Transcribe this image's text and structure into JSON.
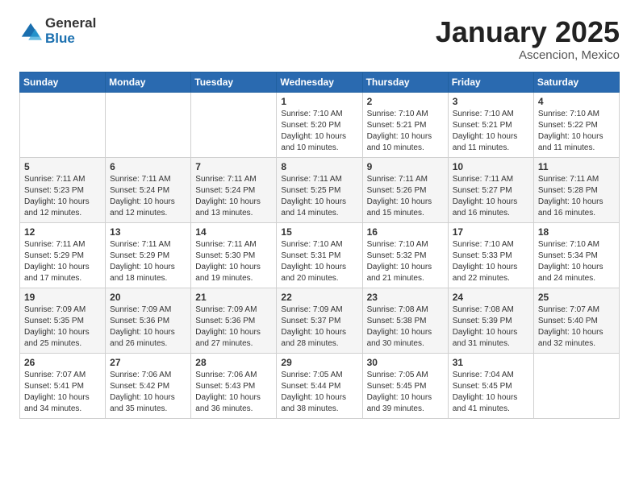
{
  "header": {
    "logo_general": "General",
    "logo_blue": "Blue",
    "title": "January 2025",
    "location": "Ascencion, Mexico"
  },
  "days_of_week": [
    "Sunday",
    "Monday",
    "Tuesday",
    "Wednesday",
    "Thursday",
    "Friday",
    "Saturday"
  ],
  "weeks": [
    [
      {
        "day": "",
        "info": ""
      },
      {
        "day": "",
        "info": ""
      },
      {
        "day": "",
        "info": ""
      },
      {
        "day": "1",
        "info": "Sunrise: 7:10 AM\nSunset: 5:20 PM\nDaylight: 10 hours\nand 10 minutes."
      },
      {
        "day": "2",
        "info": "Sunrise: 7:10 AM\nSunset: 5:21 PM\nDaylight: 10 hours\nand 10 minutes."
      },
      {
        "day": "3",
        "info": "Sunrise: 7:10 AM\nSunset: 5:21 PM\nDaylight: 10 hours\nand 11 minutes."
      },
      {
        "day": "4",
        "info": "Sunrise: 7:10 AM\nSunset: 5:22 PM\nDaylight: 10 hours\nand 11 minutes."
      }
    ],
    [
      {
        "day": "5",
        "info": "Sunrise: 7:11 AM\nSunset: 5:23 PM\nDaylight: 10 hours\nand 12 minutes."
      },
      {
        "day": "6",
        "info": "Sunrise: 7:11 AM\nSunset: 5:24 PM\nDaylight: 10 hours\nand 12 minutes."
      },
      {
        "day": "7",
        "info": "Sunrise: 7:11 AM\nSunset: 5:24 PM\nDaylight: 10 hours\nand 13 minutes."
      },
      {
        "day": "8",
        "info": "Sunrise: 7:11 AM\nSunset: 5:25 PM\nDaylight: 10 hours\nand 14 minutes."
      },
      {
        "day": "9",
        "info": "Sunrise: 7:11 AM\nSunset: 5:26 PM\nDaylight: 10 hours\nand 15 minutes."
      },
      {
        "day": "10",
        "info": "Sunrise: 7:11 AM\nSunset: 5:27 PM\nDaylight: 10 hours\nand 16 minutes."
      },
      {
        "day": "11",
        "info": "Sunrise: 7:11 AM\nSunset: 5:28 PM\nDaylight: 10 hours\nand 16 minutes."
      }
    ],
    [
      {
        "day": "12",
        "info": "Sunrise: 7:11 AM\nSunset: 5:29 PM\nDaylight: 10 hours\nand 17 minutes."
      },
      {
        "day": "13",
        "info": "Sunrise: 7:11 AM\nSunset: 5:29 PM\nDaylight: 10 hours\nand 18 minutes."
      },
      {
        "day": "14",
        "info": "Sunrise: 7:11 AM\nSunset: 5:30 PM\nDaylight: 10 hours\nand 19 minutes."
      },
      {
        "day": "15",
        "info": "Sunrise: 7:10 AM\nSunset: 5:31 PM\nDaylight: 10 hours\nand 20 minutes."
      },
      {
        "day": "16",
        "info": "Sunrise: 7:10 AM\nSunset: 5:32 PM\nDaylight: 10 hours\nand 21 minutes."
      },
      {
        "day": "17",
        "info": "Sunrise: 7:10 AM\nSunset: 5:33 PM\nDaylight: 10 hours\nand 22 minutes."
      },
      {
        "day": "18",
        "info": "Sunrise: 7:10 AM\nSunset: 5:34 PM\nDaylight: 10 hours\nand 24 minutes."
      }
    ],
    [
      {
        "day": "19",
        "info": "Sunrise: 7:09 AM\nSunset: 5:35 PM\nDaylight: 10 hours\nand 25 minutes."
      },
      {
        "day": "20",
        "info": "Sunrise: 7:09 AM\nSunset: 5:36 PM\nDaylight: 10 hours\nand 26 minutes."
      },
      {
        "day": "21",
        "info": "Sunrise: 7:09 AM\nSunset: 5:36 PM\nDaylight: 10 hours\nand 27 minutes."
      },
      {
        "day": "22",
        "info": "Sunrise: 7:09 AM\nSunset: 5:37 PM\nDaylight: 10 hours\nand 28 minutes."
      },
      {
        "day": "23",
        "info": "Sunrise: 7:08 AM\nSunset: 5:38 PM\nDaylight: 10 hours\nand 30 minutes."
      },
      {
        "day": "24",
        "info": "Sunrise: 7:08 AM\nSunset: 5:39 PM\nDaylight: 10 hours\nand 31 minutes."
      },
      {
        "day": "25",
        "info": "Sunrise: 7:07 AM\nSunset: 5:40 PM\nDaylight: 10 hours\nand 32 minutes."
      }
    ],
    [
      {
        "day": "26",
        "info": "Sunrise: 7:07 AM\nSunset: 5:41 PM\nDaylight: 10 hours\nand 34 minutes."
      },
      {
        "day": "27",
        "info": "Sunrise: 7:06 AM\nSunset: 5:42 PM\nDaylight: 10 hours\nand 35 minutes."
      },
      {
        "day": "28",
        "info": "Sunrise: 7:06 AM\nSunset: 5:43 PM\nDaylight: 10 hours\nand 36 minutes."
      },
      {
        "day": "29",
        "info": "Sunrise: 7:05 AM\nSunset: 5:44 PM\nDaylight: 10 hours\nand 38 minutes."
      },
      {
        "day": "30",
        "info": "Sunrise: 7:05 AM\nSunset: 5:45 PM\nDaylight: 10 hours\nand 39 minutes."
      },
      {
        "day": "31",
        "info": "Sunrise: 7:04 AM\nSunset: 5:45 PM\nDaylight: 10 hours\nand 41 minutes."
      },
      {
        "day": "",
        "info": ""
      }
    ]
  ]
}
